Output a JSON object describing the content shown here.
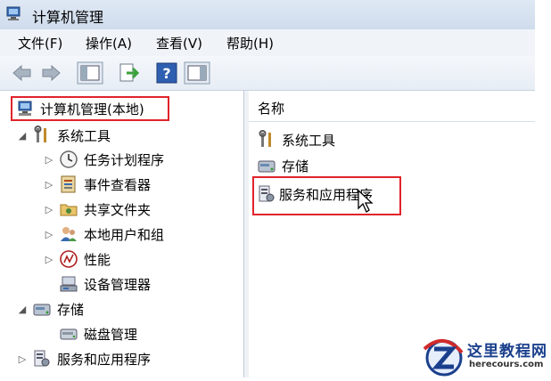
{
  "window": {
    "title": "计算机管理"
  },
  "menu": [
    "文件(F)",
    "操作(A)",
    "查看(V)",
    "帮助(H)"
  ],
  "tree": {
    "root": "计算机管理(本地)",
    "system_tools": "系统工具",
    "task_scheduler": "任务计划程序",
    "event_viewer": "事件查看器",
    "shared_folders": "共享文件夹",
    "local_users": "本地用户和组",
    "performance": "性能",
    "device_manager": "设备管理器",
    "storage": "存储",
    "disk_management": "磁盘管理",
    "services_apps": "服务和应用程序"
  },
  "list": {
    "column_name": "名称",
    "items": [
      "系统工具",
      "存储",
      "服务和应用程序"
    ]
  },
  "watermark": {
    "title": "这里教程网",
    "url": "herecours.com"
  },
  "colors": {
    "highlight": "#e0232b",
    "titlebar": "#cfdcec"
  }
}
